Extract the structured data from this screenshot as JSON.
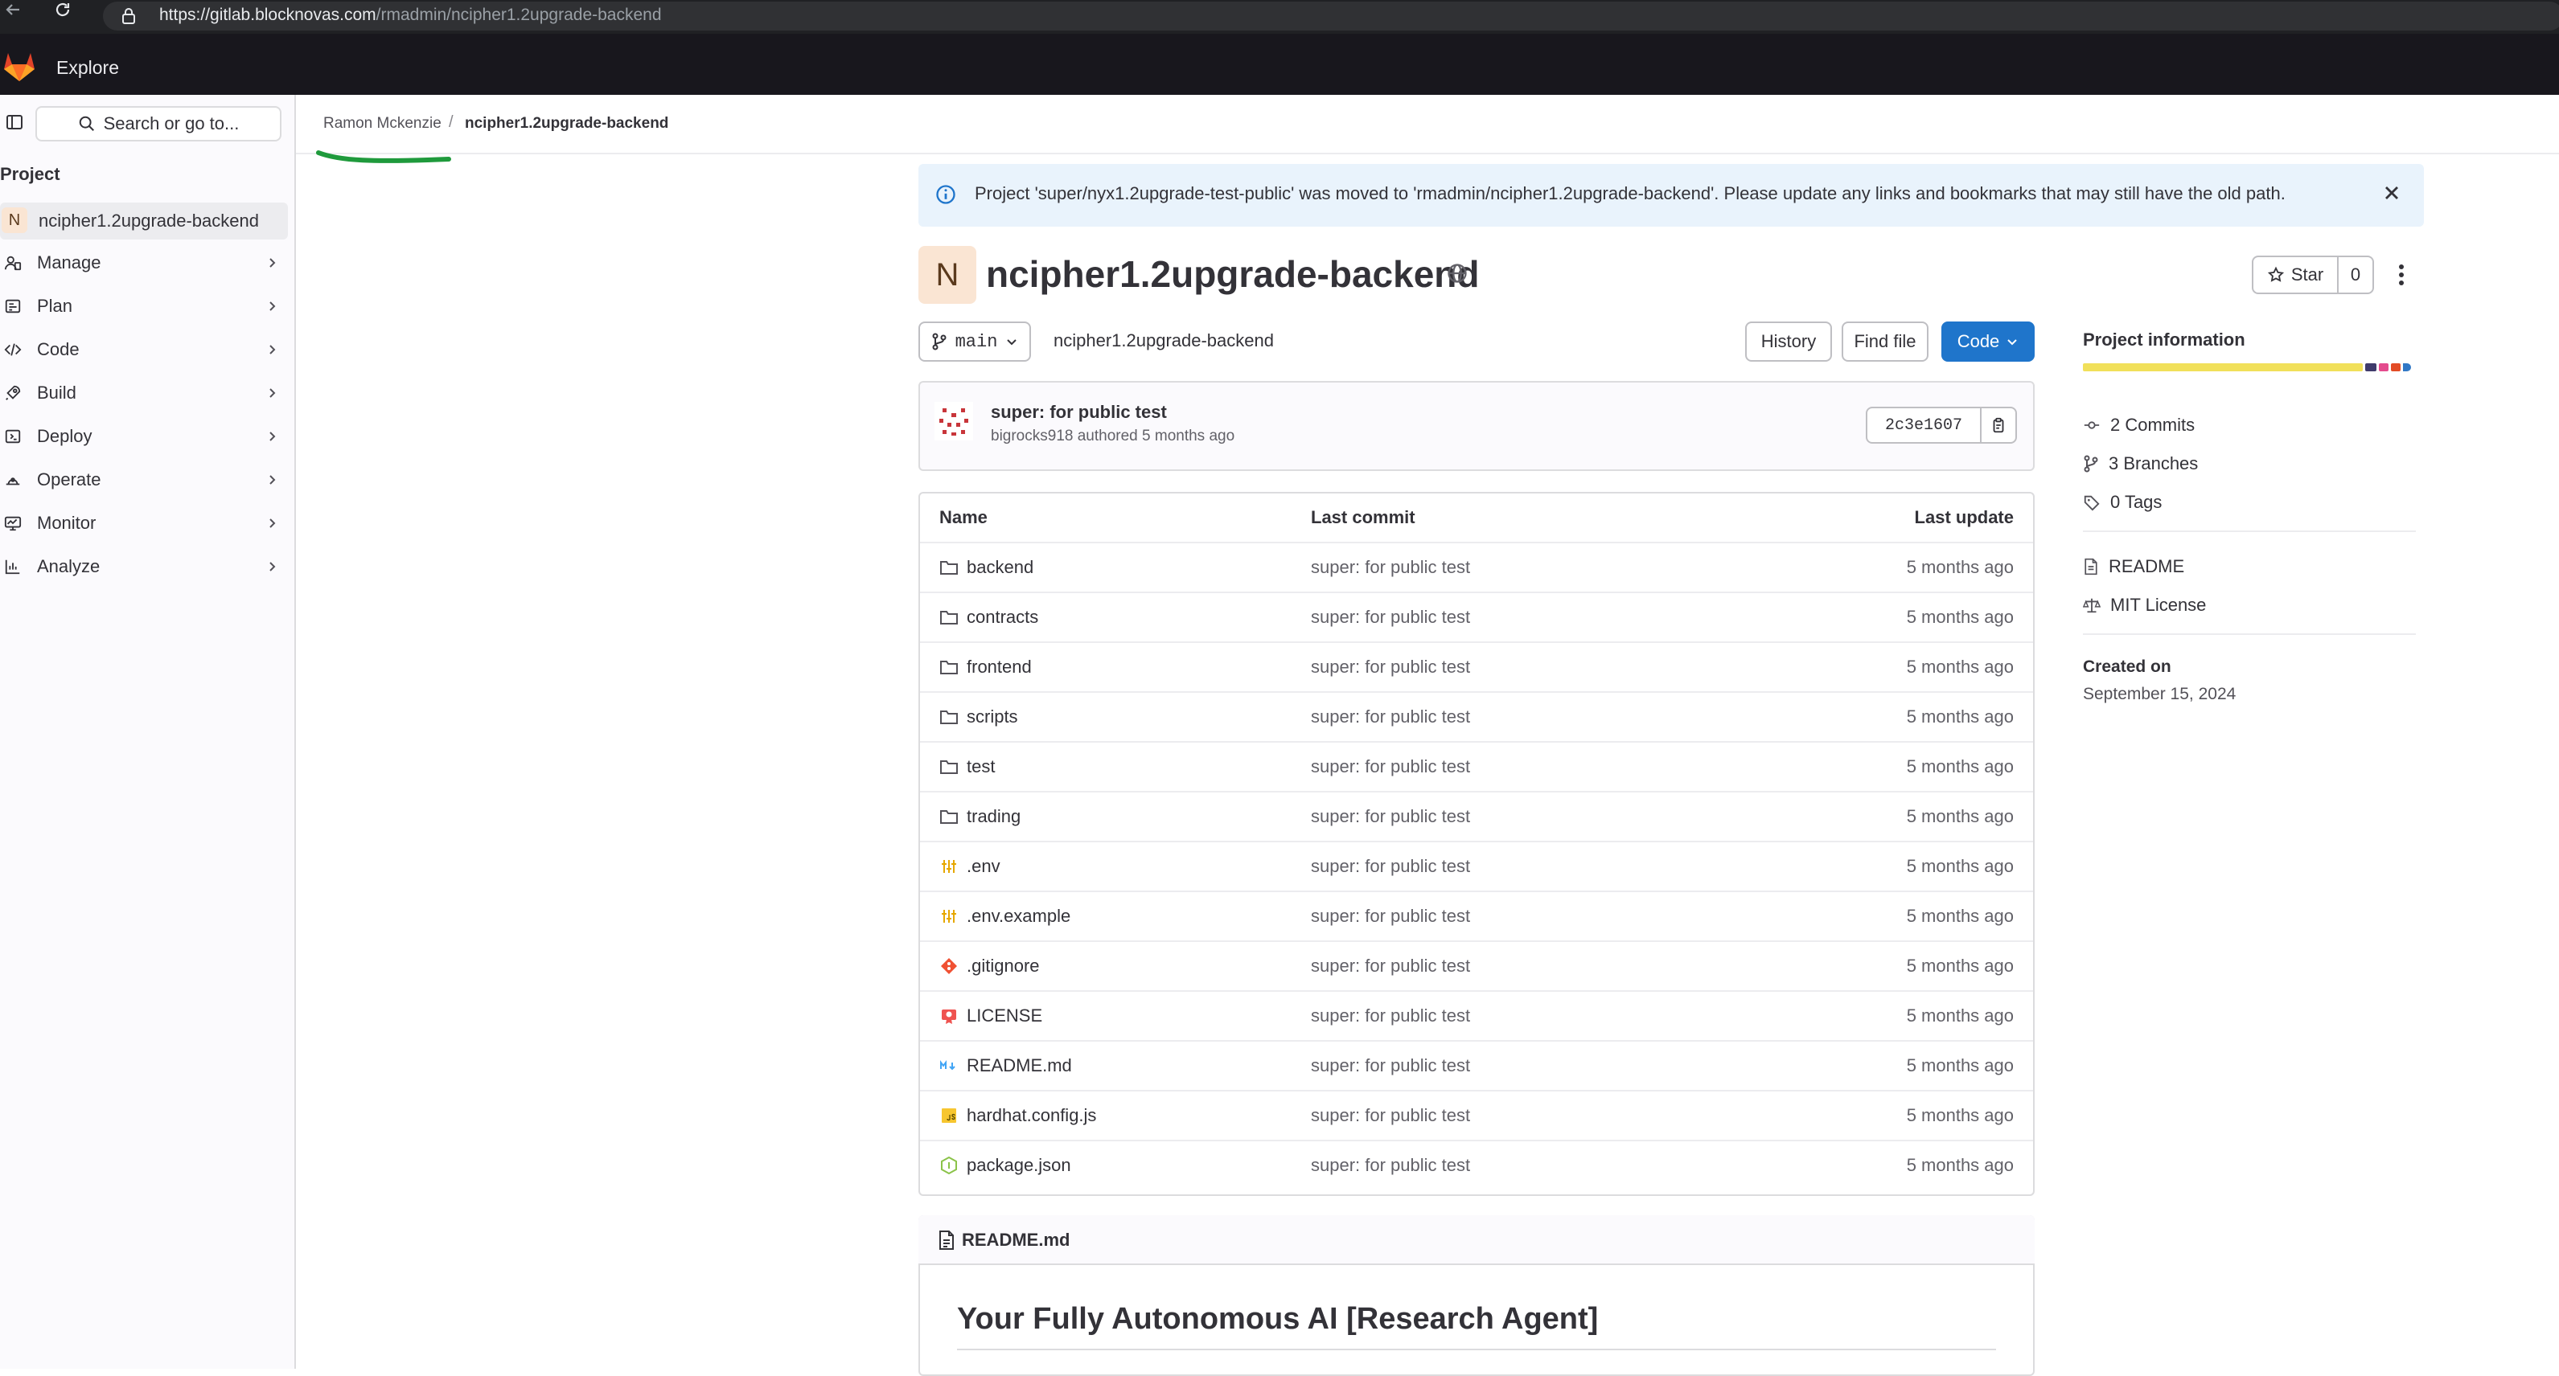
{
  "browser": {
    "url_host": "https://gitlab.blocknovas.com",
    "url_path": "/rmadmin/ncipher1.2upgrade-backend"
  },
  "topbar": {
    "explore_label": "Explore"
  },
  "sidebar": {
    "search_label": "Search or go to...",
    "section_label": "Project",
    "project_avatar_letter": "N",
    "project_name": "ncipher1.2upgrade-backend",
    "items": [
      {
        "label": "Manage",
        "icon": "users-icon"
      },
      {
        "label": "Plan",
        "icon": "plan-icon"
      },
      {
        "label": "Code",
        "icon": "code-icon"
      },
      {
        "label": "Build",
        "icon": "rocket-icon"
      },
      {
        "label": "Deploy",
        "icon": "deploy-icon"
      },
      {
        "label": "Operate",
        "icon": "operate-icon"
      },
      {
        "label": "Monitor",
        "icon": "monitor-icon"
      },
      {
        "label": "Analyze",
        "icon": "chart-icon"
      }
    ]
  },
  "breadcrumb": {
    "user": "Ramon Mckenzie",
    "separator": "/",
    "project": "ncipher1.2upgrade-backend"
  },
  "alert": {
    "message": "Project 'super/nyx1.2upgrade-test-public' was moved to 'rmadmin/ncipher1.2upgrade-backend'. Please update any links and bookmarks that may still have the old path."
  },
  "project": {
    "avatar_letter": "N",
    "title": "ncipher1.2upgrade-backend",
    "star_label": "Star",
    "star_count": "0"
  },
  "toolbar": {
    "branch": "main",
    "path": "ncipher1.2upgrade-backend",
    "history_label": "History",
    "find_file_label": "Find file",
    "code_label": "Code"
  },
  "commit": {
    "title": "super: for public test",
    "meta": "bigrocks918 authored 5 months ago",
    "sha": "2c3e1607"
  },
  "table": {
    "headers": {
      "name": "Name",
      "last_commit": "Last commit",
      "last_update": "Last update"
    },
    "rows": [
      {
        "name": "backend",
        "type": "folder",
        "commit": "super: for public test",
        "updated": "5 months ago"
      },
      {
        "name": "contracts",
        "type": "folder",
        "commit": "super: for public test",
        "updated": "5 months ago"
      },
      {
        "name": "frontend",
        "type": "folder",
        "commit": "super: for public test",
        "updated": "5 months ago"
      },
      {
        "name": "scripts",
        "type": "folder",
        "commit": "super: for public test",
        "updated": "5 months ago"
      },
      {
        "name": "test",
        "type": "folder",
        "commit": "super: for public test",
        "updated": "5 months ago"
      },
      {
        "name": "trading",
        "type": "folder",
        "commit": "super: for public test",
        "updated": "5 months ago"
      },
      {
        "name": ".env",
        "type": "env",
        "commit": "super: for public test",
        "updated": "5 months ago"
      },
      {
        "name": ".env.example",
        "type": "env",
        "commit": "super: for public test",
        "updated": "5 months ago"
      },
      {
        "name": ".gitignore",
        "type": "git",
        "commit": "super: for public test",
        "updated": "5 months ago"
      },
      {
        "name": "LICENSE",
        "type": "license",
        "commit": "super: for public test",
        "updated": "5 months ago"
      },
      {
        "name": "README.md",
        "type": "markdown",
        "commit": "super: for public test",
        "updated": "5 months ago"
      },
      {
        "name": "hardhat.config.js",
        "type": "js",
        "commit": "super: for public test",
        "updated": "5 months ago"
      },
      {
        "name": "package.json",
        "type": "node",
        "commit": "super: for public test",
        "updated": "5 months ago"
      }
    ]
  },
  "readme": {
    "file_name": "README.md",
    "heading": "Your Fully Autonomous AI [Research Agent]"
  },
  "project_info": {
    "title": "Project information",
    "commits": "2 Commits",
    "branches": "3 Branches",
    "tags": "0 Tags",
    "readme": "README",
    "license": "MIT License",
    "created_label": "Created on",
    "created_date": "September 15, 2024",
    "language_colors": [
      "#f1e05a",
      "#3f3b6b",
      "#e44b8d",
      "#e34c26",
      "#3178c6"
    ]
  },
  "colors": {
    "accent": "#1f75cb",
    "alert_bg": "#e9f3fc",
    "avatar_bg": "#fae5d3",
    "annotation_underline": "#1f9a3c"
  }
}
